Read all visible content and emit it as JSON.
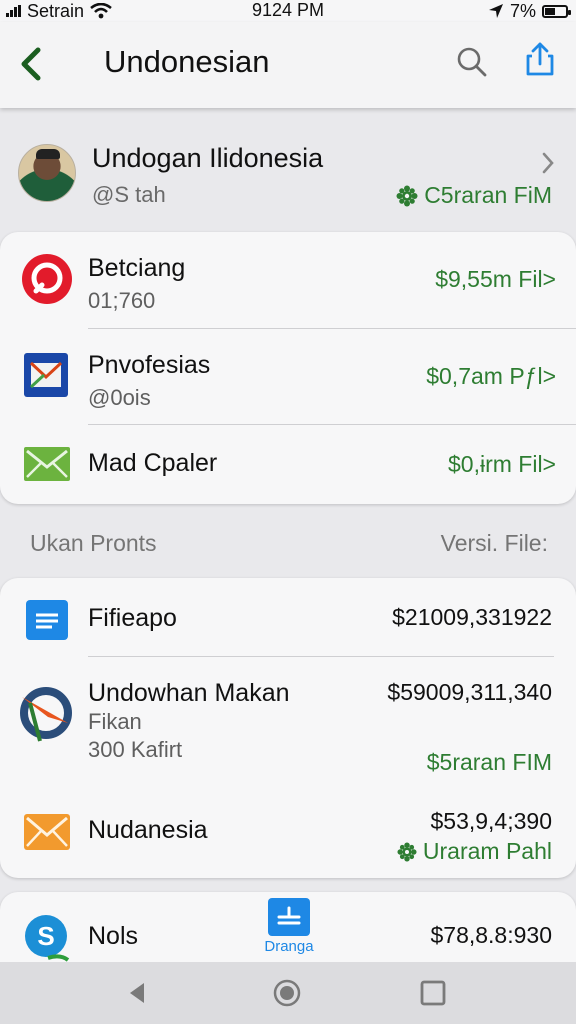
{
  "status_bar": {
    "carrier": "Setrain",
    "time": "9124 PM",
    "battery": "7%"
  },
  "app_bar": {
    "title": "Undonesian",
    "back_icon": "chevron-left-icon",
    "search_icon": "search-icon",
    "share_icon": "share-icon"
  },
  "profile": {
    "name": "Undogan Ilidonesia",
    "handle": "@S tah",
    "status": "C5raran FiM"
  },
  "accounts": [
    {
      "title": "Betciang",
      "subtitle": "01;760",
      "amount": "$9,55m Fil>",
      "icon": "target-icon"
    },
    {
      "title": "Pnvofesias",
      "subtitle": "@0ois",
      "amount": "$0,7am Pƒl>",
      "icon": "mail-icon"
    },
    {
      "title": "Mad Cpaler",
      "subtitle": "",
      "amount": "$0,ɨrm Fil>",
      "icon": "envelope-icon"
    }
  ],
  "section": {
    "left": "Ukan Pronts",
    "right": "Versi. File:"
  },
  "files": [
    {
      "title": "Fifieapo",
      "amount": "$21009,331922",
      "icon": "document-icon"
    },
    {
      "title": "Undowhan Makan",
      "sub1": "Fikan",
      "sub2": "300 Kafirt",
      "amount": "$59009,311,340",
      "status": "$5raran FIM",
      "icon": "compass-icon"
    },
    {
      "title": "Nudanesia",
      "amount": "$53,9,4;390",
      "status": "Uraram Pahl",
      "icon": "envelope-orange-icon"
    }
  ],
  "bottom_row": {
    "title": "Nols",
    "amount": "$78,8.8:930",
    "icon": "skype-icon"
  },
  "fab": {
    "label": "Dranga"
  },
  "colors": {
    "accent_green": "#2e7d32",
    "accent_blue": "#1e88e5",
    "background": "#e9e9ec"
  }
}
